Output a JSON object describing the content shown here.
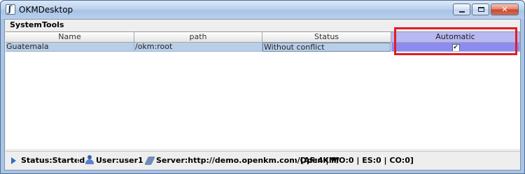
{
  "window": {
    "title": "OKMDesktop"
  },
  "menu": {
    "items": [
      "System",
      "Tools"
    ]
  },
  "table": {
    "columns": [
      "Name",
      "path",
      "Status",
      "Automatic"
    ],
    "rows": [
      {
        "name": "Guatemala",
        "path": "/okm:root",
        "status": "Without conflict",
        "automatic": "✔"
      }
    ]
  },
  "statusbar": {
    "status": "Status:Started",
    "user": "User:user1",
    "server": "Server:http://demo.openkm.com/OpenKM/",
    "counts": "[AF:4 | MO:0 | ES:0 | CO:0]"
  },
  "colors": {
    "selected_header": "#b8b8f2",
    "selected_cell": "#8c8cf0",
    "row_highlight": "#b9cfe8",
    "annotation_box": "#e21b2b"
  },
  "icons": {
    "app": "openkm-app-icon",
    "status": "play-icon",
    "user": "user-icon",
    "server": "server-icon"
  }
}
